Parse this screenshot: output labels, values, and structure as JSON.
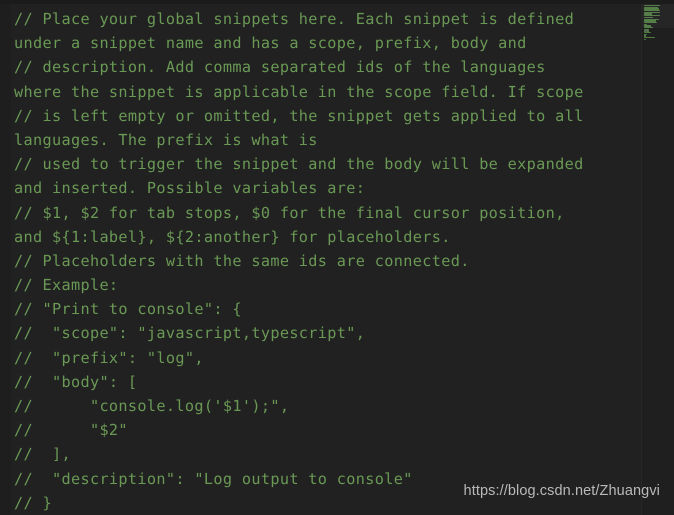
{
  "editor": {
    "title": "VS Code global snippets editor",
    "background_color": "#212121",
    "gutter_color": "#1e1e1e",
    "comment_color": "#6a9955",
    "watermark_color": "#b9b9b9",
    "font_size_px": 15,
    "line_height_px": 24
  },
  "code": {
    "language": "jsonc",
    "lines": [
      "// Place your global snippets here. Each snippet is defined",
      "under a snippet name and has a scope, prefix, body and",
      "// description. Add comma separated ids of the languages",
      "where the snippet is applicable in the scope field. If scope",
      "// is left empty or omitted, the snippet gets applied to all",
      "languages. The prefix is what is",
      "// used to trigger the snippet and the body will be expanded",
      "and inserted. Possible variables are:",
      "// $1, $2 for tab stops, $0 for the final cursor position,",
      "and ${1:label}, ${2:another} for placeholders.",
      "// Placeholders with the same ids are connected.",
      "// Example:",
      "// \"Print to console\": {",
      "//  \"scope\": \"javascript,typescript\",",
      "//  \"prefix\": \"log\",",
      "//  \"body\": [",
      "//      \"console.log('$1');\",",
      "//      \"$2\"",
      "//  ],",
      "//  \"description\": \"Log output to console\"",
      "// }"
    ]
  },
  "minimap": {
    "name": "minimap",
    "rows": [
      52,
      46,
      50,
      52,
      52,
      28,
      52,
      30,
      50,
      40,
      42,
      10,
      24,
      30,
      18,
      16,
      24,
      10,
      7,
      36,
      5
    ]
  },
  "watermark": {
    "text": "https://blog.csdn.net/Zhuangvi"
  }
}
